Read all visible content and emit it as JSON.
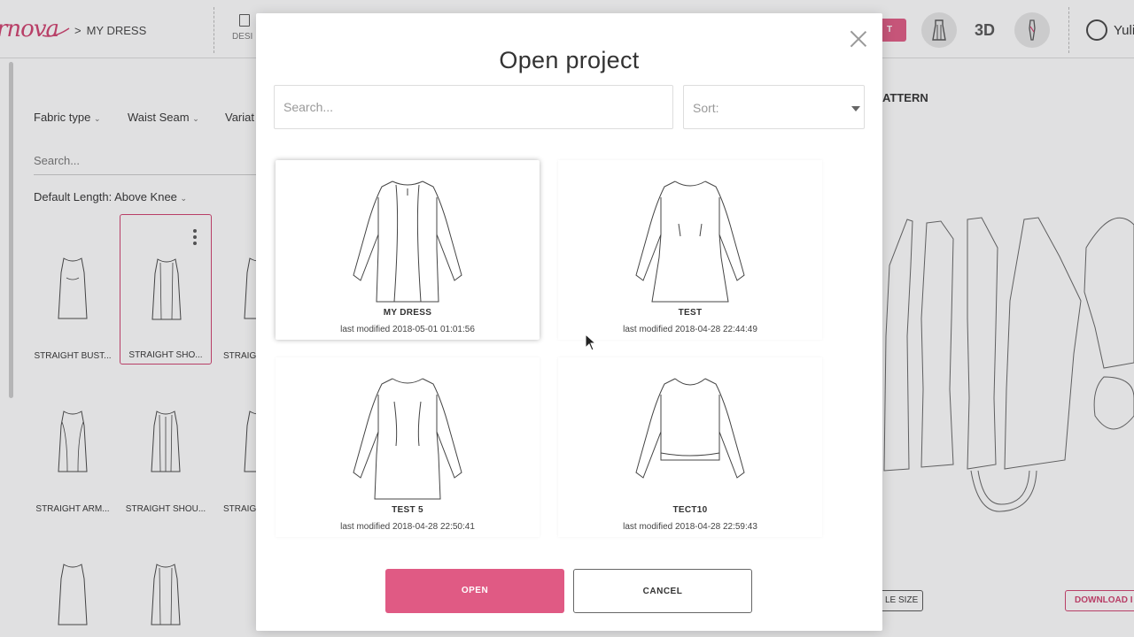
{
  "app": {
    "logo_text": "rnova",
    "breadcrumb_sep": ">",
    "breadcrumb": "MY DRESS",
    "design_tab": "DESI",
    "pill_label": "T",
    "btn_3d": "3D",
    "user_name": "Yuli",
    "accent_color": "#e05a84"
  },
  "filters": {
    "fabric_type": "Fabric type",
    "waist_seam": "Waist Seam",
    "variation": "Variat",
    "search_placeholder": "Search...",
    "default_length": "Default Length: Above Knee"
  },
  "tiles": [
    {
      "label": "STRAIGHT BUST..."
    },
    {
      "label": "STRAIGHT SHO..."
    },
    {
      "label": "STRAIG"
    },
    {
      "label": "STRAIGHT ARM..."
    },
    {
      "label": "STRAIGHT SHOU..."
    },
    {
      "label": "STRAIG"
    }
  ],
  "right_panel": {
    "pattern_title": "ATTERN",
    "size_button": "LE SIZE",
    "download_button": "DOWNLOAD I"
  },
  "modal": {
    "title": "Open project",
    "search_placeholder": "Search...",
    "sort_label": "Sort:",
    "projects": [
      {
        "name": "MY DRESS",
        "modified": "last modified 2018-05-01 01:01:56",
        "selected": true
      },
      {
        "name": "TEST",
        "modified": "last modified 2018-04-28 22:44:49",
        "selected": false
      },
      {
        "name": "TEST 5",
        "modified": "last modified 2018-04-28 22:50:41",
        "selected": false
      },
      {
        "name": "TECT10",
        "modified": "last modified 2018-04-28 22:59:43",
        "selected": false
      }
    ],
    "open_label": "OPEN",
    "cancel_label": "CANCEL"
  }
}
